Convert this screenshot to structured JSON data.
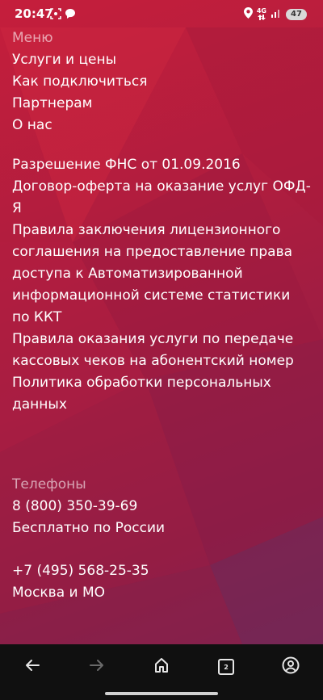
{
  "status_bar": {
    "time": "20:47",
    "network_label": "4G",
    "battery": "47",
    "icons": [
      "screenshot-icon",
      "chat-icon",
      "location-icon",
      "data-arrows-icon",
      "signal-icon"
    ]
  },
  "menu": {
    "heading": "Меню",
    "items": [
      "Услуги и цены",
      "Как подключиться",
      "Партнерам",
      "О нас"
    ]
  },
  "documents": {
    "lines": [
      "Разрешение ФНС от 01.09.2016",
      "Договор-оферта на оказание услуг ОФД-",
      "Я",
      "Правила заключения лицензионного",
      "соглашения на предоставление права",
      "доступа к Автоматизированной",
      "информационной системе статистики",
      "по ККТ",
      "Правила оказания услуги по передаче",
      "кассовых чеков на абонентский номер",
      "Политика обработки персональных",
      "данных"
    ]
  },
  "contacts": {
    "heading": "Телефоны",
    "phone_1": "8 (800) 350-39-69",
    "phone_1_note": "Бесплатно по России",
    "phone_2": "+7 (495) 568-25-35",
    "phone_2_note": "Москва и МО"
  },
  "browser_nav": {
    "tabs_count": "2",
    "icons": [
      "back-arrow-icon",
      "forward-arrow-icon",
      "home-icon",
      "tabs-icon",
      "account-icon"
    ]
  },
  "colors": {
    "background_top": "#c51e3c",
    "background_bottom": "#7e2350",
    "nav_background": "#101010"
  }
}
